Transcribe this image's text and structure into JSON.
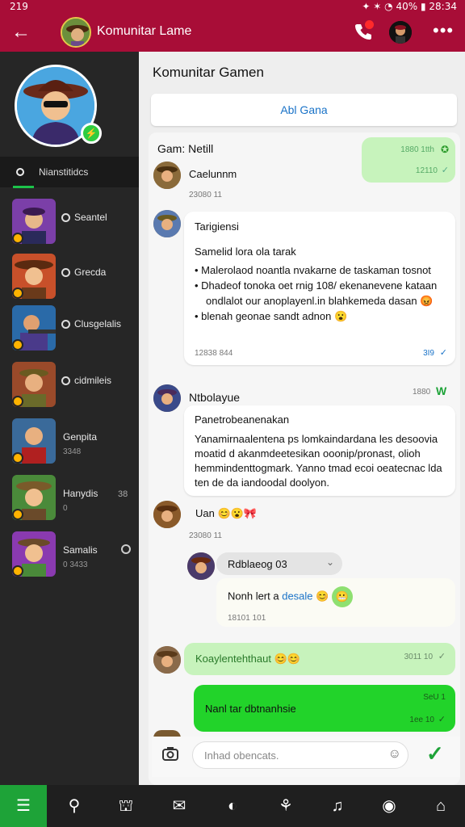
{
  "status": {
    "time": "219",
    "battery": "40%",
    "clock": "28:34"
  },
  "header": {
    "title": "Komunitar Lame"
  },
  "sidebar": {
    "section_label": "Nianstitidcs",
    "items": [
      {
        "name": "Seantel",
        "sub": "",
        "num": ""
      },
      {
        "name": "Grecda",
        "sub": "",
        "num": ""
      },
      {
        "name": "Clusgelalis",
        "sub": "",
        "num": ""
      },
      {
        "name": "cidmileis",
        "sub": "",
        "num": ""
      },
      {
        "name": "Genpita",
        "sub": "3348",
        "num": ""
      },
      {
        "name": "Hanydis",
        "sub": "0",
        "num": "38"
      },
      {
        "name": "Samalis",
        "sub": "0 3433",
        "num": ""
      }
    ]
  },
  "chat": {
    "title": "Komunitar Gamen",
    "add_button": "Abl Gana",
    "group1": {
      "label": "Gam: Netill",
      "out_time": "1880 1tth",
      "out_time2": "12110",
      "member": "Caelunnm",
      "member_time": "23080 11"
    },
    "msg2": {
      "sender": "Tarigiensi",
      "heading": "Samelid lora ola tarak",
      "bullets": [
        "Malerolaod noantla nvakarne de taskaman tosnot",
        "Dhadeof tonoka oet rnig 108/ ekenanevene kataan",
        "ondlalot our anoplayenl.in blahkemeda dasan",
        "blenah geonae sandt adnon"
      ],
      "time": "12838 844",
      "read": "3I9"
    },
    "msg3": {
      "sender": "Ntbolayue",
      "time": "1880",
      "heading": "Panetrobeanenakan",
      "body": "Yanamirnaalentena ps lomkaindardana les desoovia moatid d akanmdeetesikan ooonip/pronast, olioh hemmindenttogmark. Yanno tmad ecoi oeatecnac lda ten de da iandoodal doolyon.",
      "reply": "Uan",
      "reply_time": "23080 11"
    },
    "msg4": {
      "tag": "Rdblaeog 03",
      "text": "Nonh lert a",
      "link": "desale",
      "time": "18101 101"
    },
    "msg5": {
      "text": "Koaylentehthaut",
      "time": "3011 10"
    },
    "msg6": {
      "text": "Nanl tar dbtnanhsie",
      "time": "SeU 1",
      "time2": "1ee 10"
    },
    "input_placeholder": "Inhad obencats."
  },
  "colors": {
    "accent": "#a80d37",
    "green": "#1ea338",
    "link": "#1a73c8"
  }
}
